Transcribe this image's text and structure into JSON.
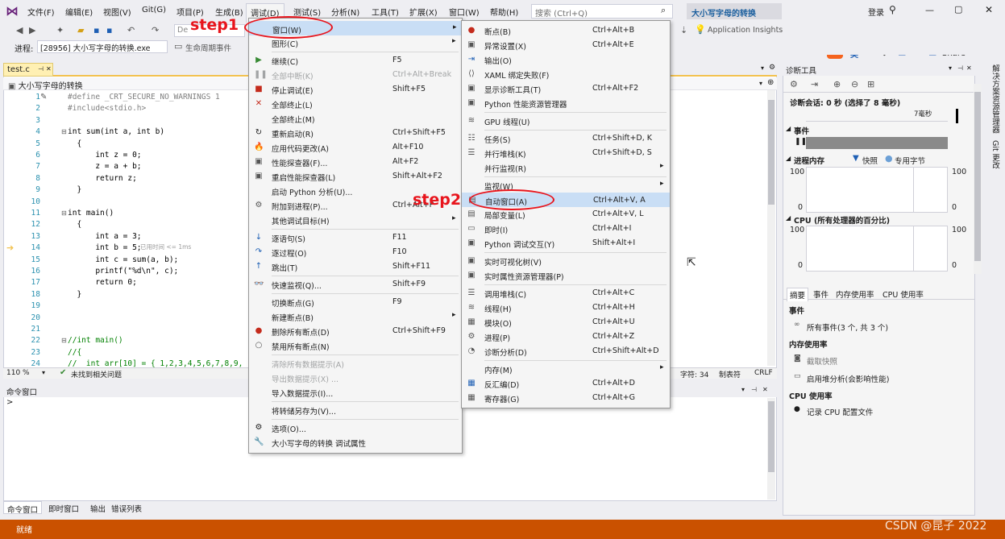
{
  "menubar": {
    "items": [
      "文件(F)",
      "编辑(E)",
      "视图(V)",
      "Git(G)",
      "项目(P)",
      "生成(B)",
      "调试(D)",
      "测试(S)",
      "分析(N)",
      "工具(T)",
      "扩展(X)",
      "窗口(W)",
      "帮助(H)"
    ],
    "search_placeholder": "搜索 (Ctrl+Q)",
    "solution_title": "大小写字母的转换",
    "login": "登录",
    "share": "Share"
  },
  "toolbar": {
    "process_label": "进程:",
    "process_value": "[28956] 大小写字母的转换.exe",
    "lifecycle": "生命周期事件",
    "app_insights": "Application Insights",
    "ime_label": "英"
  },
  "editor": {
    "tab": "test.c",
    "scope": "大小写字母的转换",
    "zoom": "110 %",
    "issues": "未找到相关问题",
    "col": "字符: 34",
    "tabs_mode": "制表符",
    "eol": "CRLF",
    "perf_tip": "已用时间 <= 1ms",
    "lines": [
      {
        "n": "1",
        "t": "#define _CRT_SECURE_NO_WARNINGS 1",
        "c": "pp"
      },
      {
        "n": "2",
        "t": "#include<stdio.h>",
        "c": "pp"
      },
      {
        "n": "3",
        "t": "",
        "c": ""
      },
      {
        "n": "4",
        "t": "int sum(int a, int b)",
        "c": ""
      },
      {
        "n": "5",
        "t": "  {",
        "c": ""
      },
      {
        "n": "6",
        "t": "      int z = 0;",
        "c": ""
      },
      {
        "n": "7",
        "t": "      z = a + b;",
        "c": ""
      },
      {
        "n": "8",
        "t": "      return z;",
        "c": ""
      },
      {
        "n": "9",
        "t": "  }",
        "c": ""
      },
      {
        "n": "10",
        "t": "",
        "c": ""
      },
      {
        "n": "11",
        "t": "int main()",
        "c": ""
      },
      {
        "n": "12",
        "t": "  {",
        "c": ""
      },
      {
        "n": "13",
        "t": "      int a = 3;",
        "c": ""
      },
      {
        "n": "14",
        "t": "      int b = 5;",
        "c": ""
      },
      {
        "n": "15",
        "t": "      int c = sum(a, b);",
        "c": ""
      },
      {
        "n": "16",
        "t": "      printf(\"%d\\n\", c);",
        "c": ""
      },
      {
        "n": "17",
        "t": "      return 0;",
        "c": ""
      },
      {
        "n": "18",
        "t": "  }",
        "c": ""
      },
      {
        "n": "19",
        "t": "",
        "c": ""
      },
      {
        "n": "20",
        "t": "",
        "c": ""
      },
      {
        "n": "21",
        "t": "",
        "c": ""
      },
      {
        "n": "22",
        "t": "//int main()",
        "c": "cm"
      },
      {
        "n": "23",
        "t": "//{",
        "c": "cm"
      },
      {
        "n": "24",
        "t": "//  int arr[10] = { 1,2,3,4,5,6,7,8,9,",
        "c": "cm"
      }
    ]
  },
  "command_window": {
    "title": "命令窗口",
    "prompt": ">",
    "tabs": [
      "命令窗口",
      "即时窗口",
      "输出",
      "错误列表"
    ]
  },
  "debug_menu": {
    "items": [
      {
        "label": "窗口(W)",
        "shortcut": "",
        "arrow": true,
        "hl": true,
        "icon": ""
      },
      {
        "label": "图形(C)",
        "shortcut": "",
        "arrow": true,
        "icon": ""
      },
      {
        "sep": true
      },
      {
        "label": "继续(C)",
        "shortcut": "F5",
        "icon": "▶",
        "iconColor": "#388a34"
      },
      {
        "label": "全部中断(K)",
        "shortcut": "Ctrl+Alt+Break",
        "dis": true,
        "icon": "❚❚",
        "iconColor": "#a2a4a5"
      },
      {
        "label": "停止调试(E)",
        "shortcut": "Shift+F5",
        "icon": "■",
        "iconColor": "#c42b1c"
      },
      {
        "label": "全部终止(L)",
        "shortcut": "",
        "icon": "✕",
        "iconColor": "#c42b1c"
      },
      {
        "label": "全部终止(M)",
        "shortcut": "",
        "icon": ""
      },
      {
        "label": "重新启动(R)",
        "shortcut": "Ctrl+Shift+F5",
        "icon": "↻",
        "iconColor": "#1e1e1e"
      },
      {
        "label": "应用代码更改(A)",
        "shortcut": "Alt+F10",
        "icon": "🔥",
        "iconColor": "#c42b1c"
      },
      {
        "label": "性能探查器(F)...",
        "shortcut": "Alt+F2",
        "icon": "▣",
        "iconColor": "#555"
      },
      {
        "label": "重启性能探查器(L)",
        "shortcut": "Shift+Alt+F2",
        "icon": "▣",
        "iconColor": "#555"
      },
      {
        "label": "启动 Python 分析(U)...",
        "shortcut": "",
        "icon": ""
      },
      {
        "label": "附加到进程(P)...",
        "shortcut": "Ctrl+Alt+P",
        "icon": "⚙",
        "iconColor": "#555"
      },
      {
        "label": "其他调试目标(H)",
        "shortcut": "",
        "arrow": true,
        "icon": ""
      },
      {
        "sep": true
      },
      {
        "label": "逐语句(S)",
        "shortcut": "F11",
        "icon": "↓",
        "iconColor": "#1e5fb4"
      },
      {
        "label": "逐过程(O)",
        "shortcut": "F10",
        "icon": "↷",
        "iconColor": "#1e5fb4"
      },
      {
        "label": "跳出(T)",
        "shortcut": "Shift+F11",
        "icon": "↑",
        "iconColor": "#1e5fb4"
      },
      {
        "sep": true
      },
      {
        "label": "快速监视(Q)...",
        "shortcut": "Shift+F9",
        "icon": "👓",
        "iconColor": "#555"
      },
      {
        "sep": true
      },
      {
        "label": "切换断点(G)",
        "shortcut": "F9",
        "icon": ""
      },
      {
        "label": "新建断点(B)",
        "shortcut": "",
        "arrow": true,
        "icon": ""
      },
      {
        "label": "删除所有断点(D)",
        "shortcut": "Ctrl+Shift+F9",
        "icon": "●",
        "iconColor": "#c42b1c"
      },
      {
        "label": "禁用所有断点(N)",
        "shortcut": "",
        "icon": "○",
        "iconColor": "#555"
      },
      {
        "sep": true
      },
      {
        "label": "清除所有数据提示(A)",
        "shortcut": "",
        "dis": true,
        "icon": ""
      },
      {
        "label": "导出数据提示(X) ...",
        "shortcut": "",
        "dis": true,
        "icon": ""
      },
      {
        "label": "导入数据提示(I)...",
        "shortcut": "",
        "icon": ""
      },
      {
        "sep": true
      },
      {
        "label": "将转储另存为(V)...",
        "shortcut": "",
        "icon": ""
      },
      {
        "sep": true
      },
      {
        "label": "选项(O)...",
        "shortcut": "",
        "icon": "⚙",
        "iconColor": "#1e1e1e"
      },
      {
        "label": "大小写字母的转换 调试属性",
        "shortcut": "",
        "icon": "🔧",
        "iconColor": "#1e1e1e"
      }
    ]
  },
  "window_menu": {
    "items": [
      {
        "label": "断点(B)",
        "shortcut": "Ctrl+Alt+B",
        "icon": "●",
        "iconColor": "#c42b1c"
      },
      {
        "label": "异常设置(X)",
        "shortcut": "Ctrl+Alt+E",
        "icon": "▣",
        "iconColor": "#555"
      },
      {
        "label": "输出(O)",
        "shortcut": "",
        "icon": "⇥",
        "iconColor": "#1e5fb4"
      },
      {
        "label": "XAML 绑定失败(F)",
        "shortcut": "",
        "icon": "⟨⟩",
        "iconColor": "#555"
      },
      {
        "label": "显示诊断工具(T)",
        "shortcut": "Ctrl+Alt+F2",
        "icon": "▣",
        "iconColor": "#555"
      },
      {
        "label": "Python 性能资源管理器",
        "shortcut": "",
        "icon": "▣",
        "iconColor": "#555"
      },
      {
        "sep": true
      },
      {
        "label": "GPU 线程(U)",
        "shortcut": "",
        "icon": "≋",
        "iconColor": "#555"
      },
      {
        "sep": true
      },
      {
        "label": "任务(S)",
        "shortcut": "Ctrl+Shift+D, K",
        "icon": "☷",
        "iconColor": "#555"
      },
      {
        "label": "并行堆栈(K)",
        "shortcut": "Ctrl+Shift+D, S",
        "icon": "☰",
        "iconColor": "#555"
      },
      {
        "label": "并行监视(R)",
        "shortcut": "",
        "arrow": true,
        "icon": ""
      },
      {
        "sep": true
      },
      {
        "label": "监视(W)",
        "shortcut": "",
        "arrow": true,
        "icon": ""
      },
      {
        "label": "自动窗口(A)",
        "shortcut": "Ctrl+Alt+V, A",
        "hl": true,
        "icon": "▤",
        "iconColor": "#555"
      },
      {
        "label": "局部变量(L)",
        "shortcut": "Ctrl+Alt+V, L",
        "icon": "▤",
        "iconColor": "#555"
      },
      {
        "label": "即时(I)",
        "shortcut": "Ctrl+Alt+I",
        "icon": "▭",
        "iconColor": "#555"
      },
      {
        "label": "Python 调试交互(Y)",
        "shortcut": "Shift+Alt+I",
        "icon": "▣",
        "iconColor": "#555"
      },
      {
        "sep": true
      },
      {
        "label": "实时可视化树(V)",
        "shortcut": "",
        "icon": "▣",
        "iconColor": "#555"
      },
      {
        "label": "实时属性资源管理器(P)",
        "shortcut": "",
        "icon": "▣",
        "iconColor": "#555"
      },
      {
        "sep": true
      },
      {
        "label": "调用堆栈(C)",
        "shortcut": "Ctrl+Alt+C",
        "icon": "☰",
        "iconColor": "#555"
      },
      {
        "label": "线程(H)",
        "shortcut": "Ctrl+Alt+H",
        "icon": "≋",
        "iconColor": "#555"
      },
      {
        "label": "模块(O)",
        "shortcut": "Ctrl+Alt+U",
        "icon": "▦",
        "iconColor": "#555"
      },
      {
        "label": "进程(P)",
        "shortcut": "Ctrl+Alt+Z",
        "icon": "⚙",
        "iconColor": "#555"
      },
      {
        "label": "诊断分析(D)",
        "shortcut": "Ctrl+Shift+Alt+D",
        "icon": "◔",
        "iconColor": "#555"
      },
      {
        "sep": true
      },
      {
        "label": "内存(M)",
        "shortcut": "",
        "arrow": true,
        "icon": ""
      },
      {
        "label": "反汇编(D)",
        "shortcut": "Ctrl+Alt+D",
        "icon": "▦",
        "iconColor": "#1e5fb4"
      },
      {
        "label": "寄存器(G)",
        "shortcut": "Ctrl+Alt+G",
        "icon": "▦",
        "iconColor": "#555"
      }
    ]
  },
  "annotations": {
    "step1": "step1",
    "step2": "step2"
  },
  "diag": {
    "title": "诊断工具",
    "session": "诊断会话: 0 秒 (选择了 8 毫秒)",
    "timeline_tick": "7毫秒",
    "events": "事件",
    "proc_mem": "进程内存",
    "snapshot": "快照",
    "private_bytes": "专用字节",
    "mem_top": "100",
    "mem_bottom": "0",
    "cpu_title": "CPU (所有处理器的百分比)",
    "cpu_top": "100",
    "cpu_bottom": "0",
    "tabs": [
      "摘要",
      "事件",
      "内存使用率",
      "CPU 使用率"
    ],
    "sec_events": "事件",
    "all_events": "所有事件(3 个, 共 3 个)",
    "sec_mem": "内存使用率",
    "take_snapshot": "截取快照",
    "heap_profile": "启用堆分析(会影响性能)",
    "sec_cpu": "CPU 使用率",
    "record_cpu": "记录 CPU 配置文件"
  },
  "right_sidebar": {
    "items": [
      "解决方案资源管理器",
      "Git 更改"
    ]
  },
  "status": {
    "ready": "就绪",
    "watermark": "CSDN @昆子 2022"
  }
}
